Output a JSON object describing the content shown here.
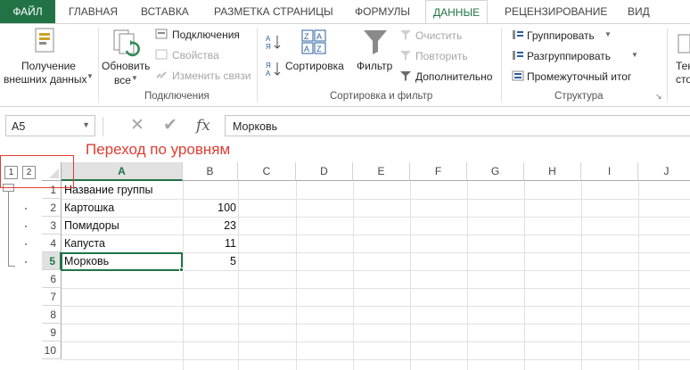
{
  "tabs": [
    {
      "id": "file",
      "label": "ФАЙЛ"
    },
    {
      "id": "home",
      "label": "ГЛАВНАЯ"
    },
    {
      "id": "insert",
      "label": "ВСТАВКА"
    },
    {
      "id": "layout",
      "label": "РАЗМЕТКА СТРАНИЦЫ"
    },
    {
      "id": "formulas",
      "label": "ФОРМУЛЫ"
    },
    {
      "id": "data",
      "label": "ДАННЫЕ"
    },
    {
      "id": "review",
      "label": "РЕЦЕНЗИРОВАНИЕ"
    },
    {
      "id": "view",
      "label": "ВИД"
    }
  ],
  "ribbon": {
    "get_external": {
      "line1": "Получение",
      "line2": "внешних данных"
    },
    "refresh": {
      "line1": "Обновить",
      "line2": "все"
    },
    "connections": "Подключения",
    "properties": "Свойства",
    "edit_links": "Изменить связи",
    "group_connections": "Подключения",
    "sort": "Сортировка",
    "filter": "Фильтр",
    "clear": "Очистить",
    "reapply": "Повторить",
    "advanced": "Дополнительно",
    "group_sort_filter": "Сортировка и фильтр",
    "group_btn": "Группировать",
    "ungroup_btn": "Разгруппировать",
    "subtotal": "Промежуточный итог",
    "group_structure": "Структура",
    "text_cut": "Тек",
    "text_cut2": "сто"
  },
  "formula_bar": {
    "name_box": "A5",
    "formula": "Морковь",
    "fx": "fx"
  },
  "annotation": "Переход по уровням",
  "outline": {
    "level1": "1",
    "level2": "2"
  },
  "grid": {
    "columns": [
      "A",
      "B",
      "C",
      "D",
      "E",
      "F",
      "G",
      "H",
      "I",
      "J"
    ],
    "rows": [
      "1",
      "2",
      "3",
      "4",
      "5",
      "6",
      "7",
      "8",
      "9",
      "10"
    ],
    "cells": [
      {
        "a": "Название группы",
        "b": ""
      },
      {
        "a": "Картошка",
        "b": "100"
      },
      {
        "a": "Помидоры",
        "b": "23"
      },
      {
        "a": "Капуста",
        "b": "11"
      },
      {
        "a": "Морковь",
        "b": "5"
      }
    ],
    "active_cell": "A5"
  },
  "colors": {
    "accent": "#217346",
    "annotation": "#e03c31"
  }
}
